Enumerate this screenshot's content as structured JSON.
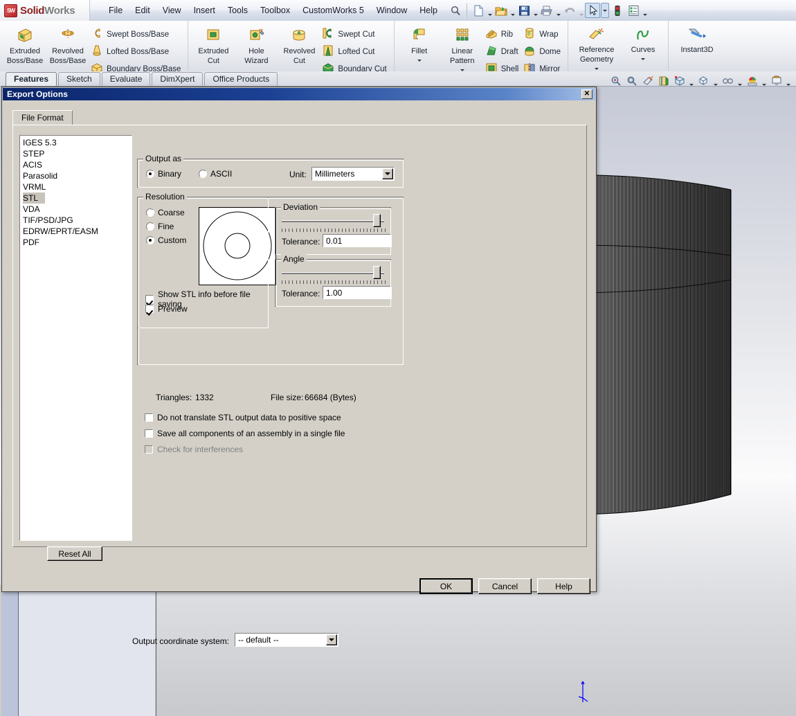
{
  "app": {
    "brand_solid": "Solid",
    "brand_works": "Works",
    "logo_mark": "SW",
    "menus": [
      "File",
      "Edit",
      "View",
      "Insert",
      "Tools",
      "Toolbox",
      "CustomWorks 5",
      "Window",
      "Help"
    ],
    "menu_icons": [
      "search-icon",
      "new-document-icon",
      "open-folder-icon",
      "save-icon",
      "print-icon",
      "undo-icon",
      "select-arrow-icon",
      "traffic-light-icon",
      "options-icon"
    ]
  },
  "ribbon": {
    "groups": [
      {
        "big": [
          {
            "label_line1": "Extruded",
            "label_line2": "Boss/Base",
            "icon": "extruded-boss-icon",
            "has_dropdown": false
          },
          {
            "label_line1": "Revolved",
            "label_line2": "Boss/Base",
            "icon": "revolved-boss-icon",
            "has_dropdown": false
          }
        ],
        "small": [
          {
            "label": "Swept Boss/Base",
            "icon": "swept-boss-icon"
          },
          {
            "label": "Lofted Boss/Base",
            "icon": "lofted-boss-icon"
          },
          {
            "label": "Boundary Boss/Base",
            "icon": "boundary-boss-icon"
          }
        ]
      },
      {
        "big": [
          {
            "label_line1": "Extruded",
            "label_line2": "Cut",
            "icon": "extruded-cut-icon",
            "has_dropdown": false
          },
          {
            "label_line1": "Hole",
            "label_line2": "Wizard",
            "icon": "hole-wizard-icon",
            "has_dropdown": false
          },
          {
            "label_line1": "Revolved",
            "label_line2": "Cut",
            "icon": "revolved-cut-icon",
            "has_dropdown": false
          }
        ],
        "small": [
          {
            "label": "Swept Cut",
            "icon": "swept-cut-icon"
          },
          {
            "label": "Lofted Cut",
            "icon": "lofted-cut-icon"
          },
          {
            "label": "Boundary Cut",
            "icon": "boundary-cut-icon"
          }
        ]
      },
      {
        "big": [
          {
            "label_line1": "Fillet",
            "label_line2": "",
            "icon": "fillet-icon",
            "has_dropdown": true
          },
          {
            "label_line1": "Linear",
            "label_line2": "Pattern",
            "icon": "linear-pattern-icon",
            "has_dropdown": true
          }
        ],
        "small": [
          {
            "label": "Rib",
            "icon": "rib-icon"
          },
          {
            "label": "Draft",
            "icon": "draft-icon"
          },
          {
            "label": "Shell",
            "icon": "shell-icon"
          }
        ],
        "small2": [
          {
            "label": "Wrap",
            "icon": "wrap-icon"
          },
          {
            "label": "Dome",
            "icon": "dome-icon"
          },
          {
            "label": "Mirror",
            "icon": "mirror-icon"
          }
        ]
      },
      {
        "big": [
          {
            "label_line1": "Reference",
            "label_line2": "Geometry",
            "icon": "reference-geometry-icon",
            "has_dropdown": true
          },
          {
            "label_line1": "Curves",
            "label_line2": "",
            "icon": "curves-icon",
            "has_dropdown": true
          }
        ],
        "small": []
      },
      {
        "big": [
          {
            "label_line1": "Instant3D",
            "label_line2": "",
            "icon": "instant3d-icon",
            "has_dropdown": false
          }
        ],
        "small": []
      }
    ]
  },
  "command_tabs": {
    "tabs": [
      "Features",
      "Sketch",
      "Evaluate",
      "DimXpert",
      "Office Products"
    ],
    "active": "Features"
  },
  "view_toolbar": {
    "icons": [
      "zoom-to-fit-icon",
      "zoom-to-area-icon",
      "section-view-icon",
      "view-orientation-icon",
      "display-style-icon",
      "hide-show-icon",
      "edit-appearance-icon",
      "apply-scene-icon",
      "view-settings-icon"
    ]
  },
  "dialog": {
    "title": "Export Options",
    "close_icon": "close-icon",
    "tab_label": "File Format",
    "file_formats": [
      "IGES 5.3",
      "STEP",
      "ACIS",
      "Parasolid",
      "VRML",
      "STL",
      "VDA",
      "TIF/PSD/JPG",
      "EDRW/EPRT/EASM",
      "PDF"
    ],
    "selected_format": "STL",
    "reset_all": "Reset All",
    "output_as": {
      "legend": "Output as",
      "binary": "Binary",
      "ascii": "ASCII",
      "selected": "Binary",
      "unit_label": "Unit:",
      "unit_value": "Millimeters"
    },
    "resolution": {
      "legend": "Resolution",
      "options": [
        "Coarse",
        "Fine",
        "Custom"
      ],
      "selected": "Custom",
      "preview_icon": "annulus-preview",
      "show_info_label": "Show STL info before file saving",
      "show_info_checked": true,
      "preview_label": "Preview",
      "preview_checked": true,
      "triangles_label": "Triangles:",
      "triangles_value": "1332",
      "filesize_label": "File size:",
      "filesize_value": "66684 (Bytes)"
    },
    "deviation": {
      "legend": "Deviation",
      "tolerance_label": "Tolerance:",
      "tolerance_value": "0.01",
      "slider_pct": 93
    },
    "angle": {
      "legend": "Angle",
      "tolerance_label": "Tolerance:",
      "tolerance_value": "1.00",
      "slider_pct": 93
    },
    "checkboxes": [
      {
        "label": "Do not translate STL output data to positive space",
        "checked": false,
        "disabled": false
      },
      {
        "label": "Save all components of an assembly in a single file",
        "checked": false,
        "disabled": false
      },
      {
        "label": "Check for interferences",
        "checked": false,
        "disabled": true
      }
    ],
    "coord_system": {
      "label": "Output coordinate system:",
      "value": "-- default --"
    },
    "buttons": {
      "ok": "OK",
      "cancel": "Cancel",
      "help": "Help"
    }
  },
  "colors": {
    "dialog_face": "#d4d0c8",
    "title_bar_start": "#0a246a",
    "title_bar_end": "#a6c0e8",
    "selection": "#c8c4bc",
    "brand_red": "#8b1f1f",
    "triad_blue": "#0000ff"
  }
}
